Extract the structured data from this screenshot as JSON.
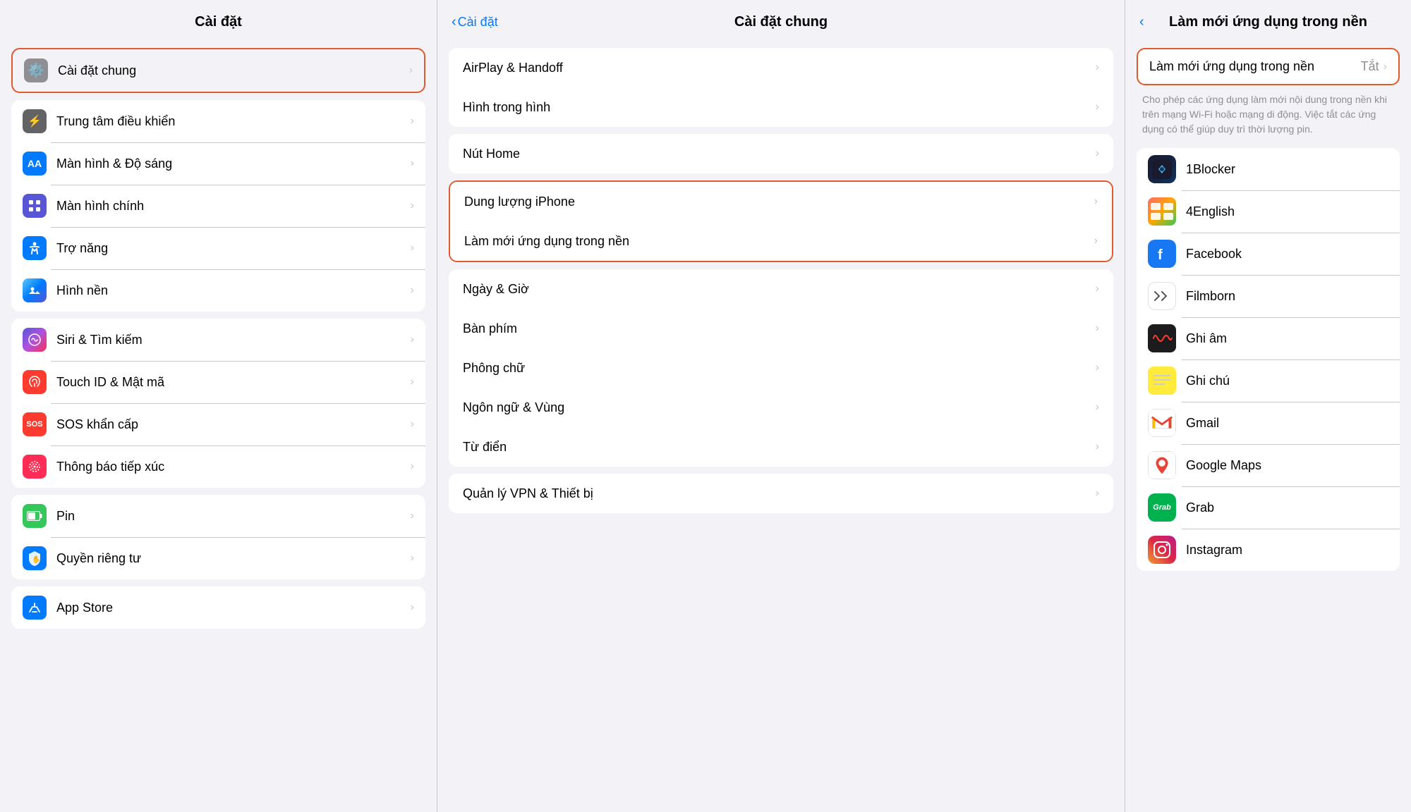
{
  "leftCol": {
    "title": "Cài đặt",
    "items": [
      {
        "id": "cai-dat-chung",
        "icon": "⚙️",
        "iconBg": "icon-gray",
        "label": "Cài đặt chung",
        "selected": true
      },
      {
        "id": "trung-tam-dieu-khien",
        "icon": "🎛️",
        "iconBg": "icon-gray2",
        "label": "Trung tâm điều khiển",
        "selected": false
      },
      {
        "id": "man-hinh-do-sang",
        "icon": "AA",
        "iconBg": "icon-blue",
        "label": "Màn hình & Độ sáng",
        "selected": false
      },
      {
        "id": "man-hinh-chinh",
        "icon": "🔲",
        "iconBg": "icon-blue2",
        "label": "Màn hình chính",
        "selected": false
      },
      {
        "id": "tro-nang",
        "icon": "♿",
        "iconBg": "icon-blue",
        "label": "Trợ năng",
        "selected": false
      },
      {
        "id": "hinh-nen",
        "icon": "✦",
        "iconBg": "icon-teal",
        "label": "Hình nền",
        "selected": false
      },
      {
        "id": "siri-tim-kiem",
        "icon": "◎",
        "iconBg": "icon-indigo",
        "label": "Siri & Tìm kiếm",
        "selected": false
      },
      {
        "id": "touch-id-mat-ma",
        "icon": "👆",
        "iconBg": "icon-red",
        "label": "Touch ID & Mật mã",
        "selected": false
      },
      {
        "id": "sos-khan-cap",
        "icon": "SOS",
        "iconBg": "icon-red2",
        "label": "SOS khẩn cấp",
        "selected": false
      },
      {
        "id": "thong-bao-tiep-xuc",
        "icon": "◉",
        "iconBg": "icon-pink",
        "label": "Thông báo tiếp xúc",
        "selected": false
      },
      {
        "id": "pin",
        "icon": "🔋",
        "iconBg": "icon-green",
        "label": "Pin",
        "selected": false
      },
      {
        "id": "quyen-rieng-tu",
        "icon": "✋",
        "iconBg": "icon-blue-app",
        "label": "Quyền riêng tư",
        "selected": false
      },
      {
        "id": "app-store",
        "icon": "A",
        "iconBg": "icon-blue",
        "label": "App Store",
        "selected": false
      }
    ]
  },
  "middleCol": {
    "title": "Cài đặt chung",
    "backLabel": "Cài đặt",
    "sections": [
      {
        "items": [
          {
            "id": "airplay-handoff",
            "label": "AirPlay & Handoff"
          },
          {
            "id": "hinh-trong-hinh",
            "label": "Hình trong hình"
          }
        ]
      },
      {
        "items": [
          {
            "id": "nut-home",
            "label": "Nút Home"
          }
        ]
      },
      {
        "items": [
          {
            "id": "dung-luong-iphone",
            "label": "Dung lượng iPhone"
          },
          {
            "id": "lam-moi-ung-dung",
            "label": "Làm mới ứng dụng trong nền",
            "selected": true
          }
        ]
      },
      {
        "items": [
          {
            "id": "ngay-gio",
            "label": "Ngày & Giờ"
          },
          {
            "id": "ban-phim",
            "label": "Bàn phím"
          },
          {
            "id": "phong-chu",
            "label": "Phông chữ"
          },
          {
            "id": "ngon-ngu-vung",
            "label": "Ngôn ngữ & Vùng"
          },
          {
            "id": "tu-dien",
            "label": "Từ điển"
          }
        ]
      },
      {
        "items": [
          {
            "id": "quan-ly-vpn",
            "label": "Quản lý VPN & Thiết bị"
          }
        ]
      }
    ]
  },
  "rightCol": {
    "title": "Làm mới ứng dụng trong nền",
    "backIcon": "<",
    "toggleSection": {
      "label": "Làm mới ứng dụng trong nền",
      "value": "Tắt"
    },
    "description": "Cho phép các ứng dụng làm mới nội dung trong nền khi trên mạng Wi-Fi hoặc mạng di động. Việc tắt các ứng dụng có thể giúp duy trì thời lượng pin.",
    "apps": [
      {
        "id": "1blocker",
        "name": "1Blocker",
        "iconClass": "app-1blocker",
        "iconText": "🛡"
      },
      {
        "id": "4english",
        "name": "4English",
        "iconClass": "app-4english",
        "iconText": "📚"
      },
      {
        "id": "facebook",
        "name": "Facebook",
        "iconClass": "app-facebook",
        "iconText": "f"
      },
      {
        "id": "filmborn",
        "name": "Filmborn",
        "iconClass": "app-filmborn",
        "iconText": "✉"
      },
      {
        "id": "ghi-am",
        "name": "Ghi âm",
        "iconClass": "app-ghiam",
        "iconText": "🎙"
      },
      {
        "id": "ghi-chu",
        "name": "Ghi chú",
        "iconClass": "app-ghichu",
        "iconText": "📝"
      },
      {
        "id": "gmail",
        "name": "Gmail",
        "iconClass": "app-gmail",
        "iconText": "M"
      },
      {
        "id": "google-maps",
        "name": "Google Maps",
        "iconClass": "app-googlemaps",
        "iconText": "📍"
      },
      {
        "id": "grab",
        "name": "Grab",
        "iconClass": "app-grab",
        "iconText": "Grab"
      },
      {
        "id": "instagram",
        "name": "Instagram",
        "iconClass": "app-instagram",
        "iconText": "📷"
      }
    ]
  }
}
